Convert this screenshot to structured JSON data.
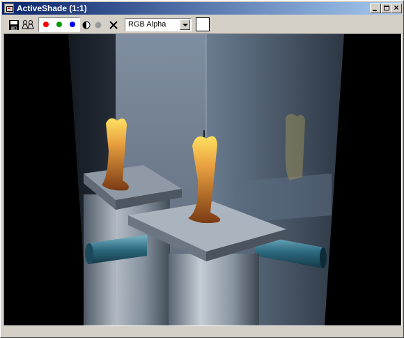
{
  "window": {
    "title": "ActiveShade (1:1)"
  },
  "titlebar": {
    "minimize_icon": "minimize-icon",
    "maximize_icon": "maximize-icon",
    "close_icon": "close-icon"
  },
  "toolbar": {
    "save_icon": "floppy-disk-icon",
    "clone_icon": "clone-window-icon",
    "channels": [
      {
        "name": "red",
        "color": "#ff0000"
      },
      {
        "name": "green",
        "color": "#009900"
      },
      {
        "name": "blue",
        "color": "#0000ff"
      }
    ],
    "alpha_icon": "half-circle-icon",
    "mono_icon": "gray-dot-icon",
    "clear_icon": "x-icon",
    "channel_select": {
      "value": "RGB Alpha"
    },
    "swatch_color": "#ffffff"
  },
  "colors": {
    "title_start": "#0a246a",
    "title_end": "#a6caf0",
    "chrome": "#d4d0c8"
  }
}
